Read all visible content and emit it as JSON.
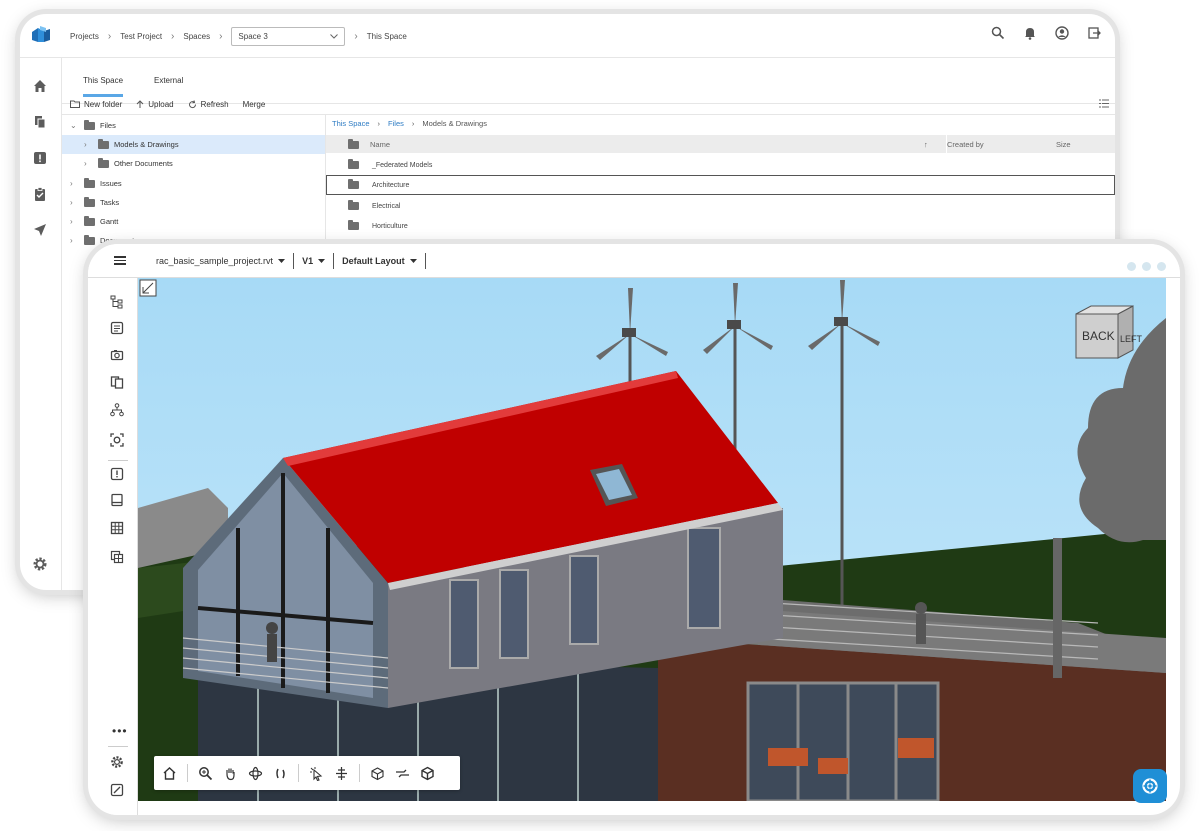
{
  "breadcrumb": {
    "items": [
      "Projects",
      "Test Project",
      "Spaces"
    ],
    "space_select": "Space 3",
    "current": "This Space"
  },
  "tabs": {
    "this_space": "This Space",
    "external": "External"
  },
  "toolbar": {
    "new_folder": "New folder",
    "upload": "Upload",
    "refresh": "Refresh",
    "merge": "Merge"
  },
  "tree": {
    "files": "Files",
    "models": "Models & Drawings",
    "other_docs": "Other Documents",
    "issues": "Issues",
    "tasks": "Tasks",
    "gantt": "Gantt",
    "document": "Document"
  },
  "file_panel": {
    "crumbs": [
      "This Space",
      "Files",
      "Models & Drawings"
    ],
    "columns": {
      "name": "Name",
      "created_by": "Created by",
      "size": "Size"
    },
    "rows": [
      "_Federated Models",
      "Architecture",
      "Electrical",
      "Horticulture"
    ]
  },
  "viewer": {
    "file_name": "rac_basic_sample_project.rvt",
    "version": "V1",
    "layout": "Default Layout",
    "viewcube": {
      "back": "BACK",
      "left": "LEFT"
    }
  },
  "colors": {
    "accent": "#5aa7e6",
    "roof": "#c00000",
    "sky": "#a9dcf7",
    "fab": "#1f8fd6"
  }
}
